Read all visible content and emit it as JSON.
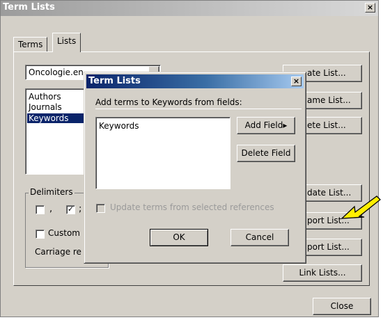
{
  "main_window": {
    "title": "Term Lists",
    "close_glyph": "×",
    "tabs": [
      {
        "label": "Terms"
      },
      {
        "label": "Lists"
      }
    ],
    "dropdown_value": "Oncologie.en",
    "lists": [
      "Authors",
      "Journals",
      "Keywords"
    ],
    "selected_list": "Keywords",
    "buttons": {
      "create_list": "ate List...",
      "rename_list": "ame List...",
      "delete_list": "ete List...",
      "update_list": "date List...",
      "import_list": "port List...",
      "export_list": "port List...",
      "link_lists": "Link Lists...",
      "close": "Close"
    },
    "delimiters": {
      "legend": "Delimiters",
      "comma_label": ",",
      "semicolon_label": ";",
      "check_glyph": "✓",
      "custom_label": "Custom",
      "carriage_label": "Carriage re"
    }
  },
  "dialog": {
    "title": "Term Lists",
    "close_glyph": "×",
    "instruction": "Add terms to Keywords from fields:",
    "fields": [
      "Keywords"
    ],
    "add_field_label": "Add Field",
    "add_field_arrow": "▸",
    "delete_field_label": "Delete Field",
    "update_checkbox_label": "Update terms from selected references",
    "ok_label": "OK",
    "cancel_label": "Cancel"
  },
  "annotation": {
    "arrow_color": "#ffee00"
  }
}
